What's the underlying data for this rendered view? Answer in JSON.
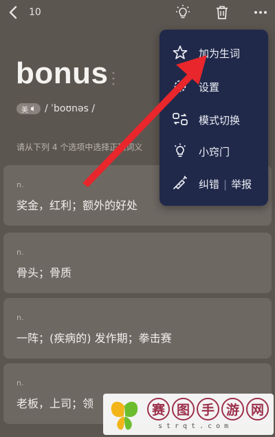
{
  "header": {
    "counter": "10"
  },
  "word": {
    "text": "bonus",
    "accent_label": "美",
    "phonetic": "/ ˈboʊnəs /"
  },
  "instruction": "请从下列 4 个选项中选择正确词义",
  "options": [
    {
      "pos": "n.",
      "definition": "奖金，红利；额外的好处"
    },
    {
      "pos": "n.",
      "definition": "骨头；骨质"
    },
    {
      "pos": "n.",
      "definition": "一阵；(疾病的) 发作期；拳击赛"
    },
    {
      "pos": "n.",
      "definition": "老板，上司；领"
    }
  ],
  "menu": {
    "items": [
      {
        "label": "加为生词",
        "icon": "star-icon"
      },
      {
        "label": "设置",
        "icon": "settings-icon"
      },
      {
        "label": "模式切换",
        "icon": "mode-switch-icon"
      },
      {
        "label": "小窍门",
        "icon": "bulb-icon"
      },
      {
        "label": "纠错",
        "label2": "举报",
        "separator": "|",
        "icon": "syringe-icon"
      }
    ]
  },
  "watermark": {
    "chars": [
      "赛",
      "图",
      "手",
      "游",
      "网"
    ],
    "url": "strqt.com"
  },
  "colors": {
    "background": "#5c5651",
    "card": "#6e6863",
    "menu": "#20294a",
    "arrow": "#e8262b"
  }
}
